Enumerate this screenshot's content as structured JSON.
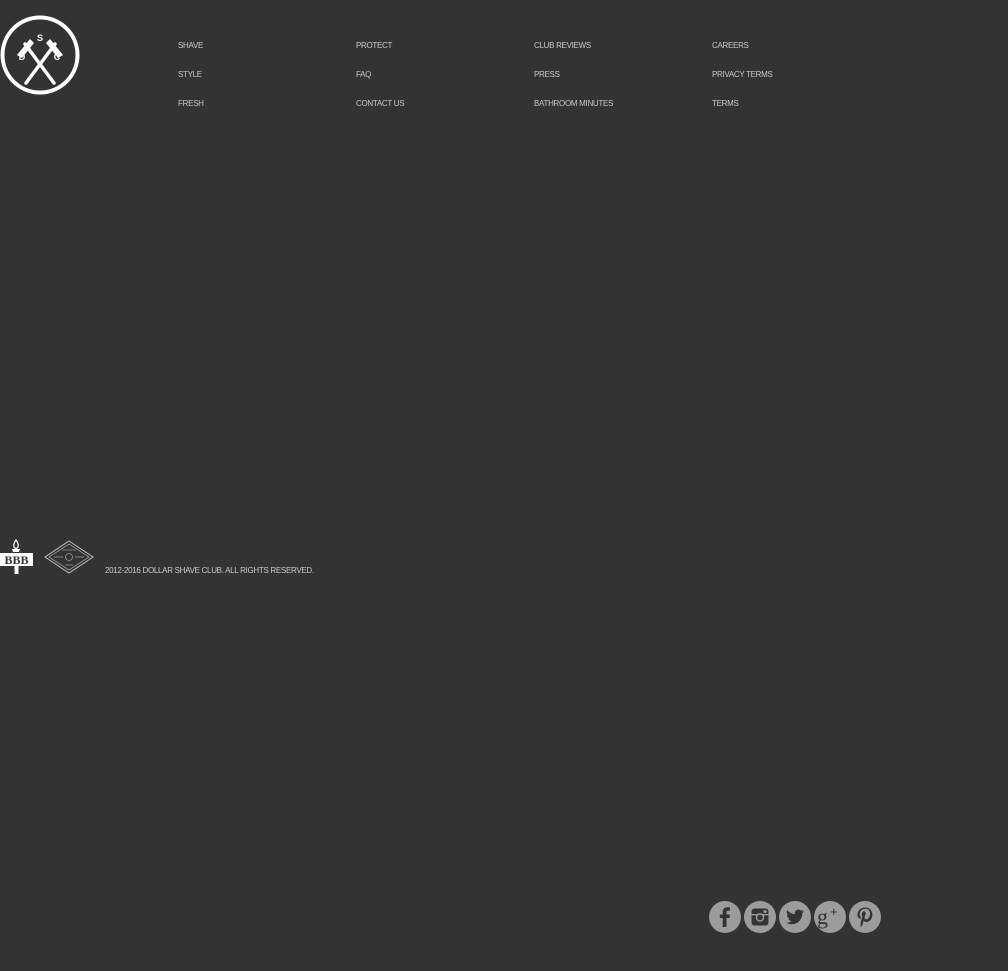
{
  "colors": {
    "background": "#333333",
    "link_text": "#c9c9c9",
    "logo": "#ffffff",
    "social_icon_bg": "#9c9c9c",
    "social_icon_fg": "#333333"
  },
  "logo": {
    "letters": [
      "S",
      "D",
      "C"
    ],
    "icon": "crossed-razors-logo-icon"
  },
  "nav": {
    "columns": [
      {
        "links": [
          "SHAVE",
          "STYLE",
          "FRESH"
        ]
      },
      {
        "links": [
          "PROTECT",
          "FAQ",
          "CONTACT US"
        ]
      },
      {
        "links": [
          "CLUB REVIEWS",
          "PRESS",
          "BATHROOM MINUTES"
        ]
      },
      {
        "links": [
          "CAREERS",
          "PRIVACY TERMS",
          "TERMS"
        ]
      }
    ]
  },
  "badges": {
    "bbb_text": "BBB",
    "bbb_icon": "bbb-torch-icon",
    "diamond_icon": "diamond-seal-icon"
  },
  "footer": {
    "copyright": "2012-2016 DOLLAR SHAVE CLUB. ALL RIGHTS RESERVED."
  },
  "social": [
    {
      "icon": "facebook-icon"
    },
    {
      "icon": "instagram-icon"
    },
    {
      "icon": "twitter-icon"
    },
    {
      "icon": "google-plus-icon"
    },
    {
      "icon": "pinterest-icon"
    }
  ]
}
